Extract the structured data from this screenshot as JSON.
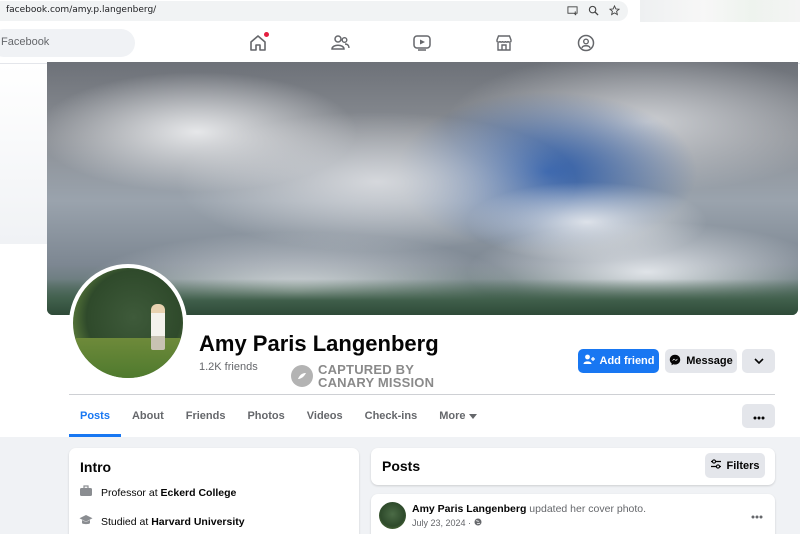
{
  "browser": {
    "url": "facebook.com/amy.p.langenberg/"
  },
  "topnav": {
    "search_text": "Facebook"
  },
  "profile": {
    "name": "Amy Paris Langenberg",
    "friends": "1.2K friends",
    "watermark_line1": "CAPTURED BY",
    "watermark_line2": "CANARY MISSION"
  },
  "actions": {
    "add_friend": "Add friend",
    "message": "Message"
  },
  "tabs": [
    {
      "label": "Posts",
      "active": true
    },
    {
      "label": "About"
    },
    {
      "label": "Friends"
    },
    {
      "label": "Photos"
    },
    {
      "label": "Videos"
    },
    {
      "label": "Check-ins"
    },
    {
      "label": "More"
    }
  ],
  "intro": {
    "title": "Intro",
    "work_prefix": "Professor at",
    "work_place": "Eckerd College",
    "edu_prefix": "Studied at",
    "edu_place": "Harvard University"
  },
  "posts": {
    "title": "Posts",
    "filters": "Filters",
    "first_post": {
      "author": "Amy Paris Langenberg",
      "action": "updated her cover photo.",
      "date": "July 23, 2024 · "
    }
  },
  "colors": {
    "accent": "#1877f2",
    "notification": "#e41e3f",
    "secondary_button": "#e4e6eb"
  },
  "icons": [
    "home-icon",
    "friends-icon",
    "watch-icon",
    "marketplace-icon",
    "groups-icon",
    "add-person-icon",
    "messenger-icon",
    "chevron-down-icon",
    "more-dots-icon",
    "filters-icon",
    "briefcase-icon",
    "graduation-cap-icon",
    "globe-icon"
  ]
}
